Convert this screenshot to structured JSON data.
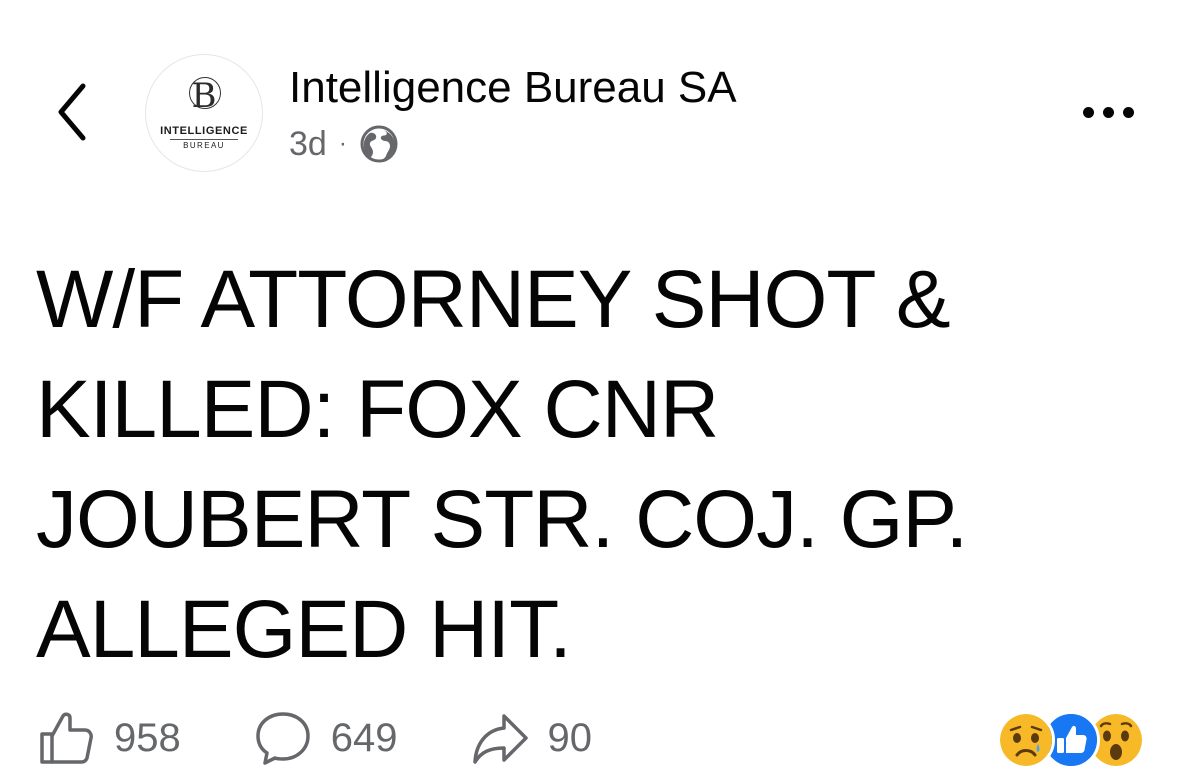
{
  "header": {
    "page_name": "Intelligence Bureau SA",
    "timestamp": "3d",
    "separator": "·",
    "audience_icon": "globe-icon"
  },
  "avatar": {
    "monogram": "B",
    "line1": "INTELLIGENCE",
    "line2": "BUREAU"
  },
  "post": {
    "text": "W/F ATTORNEY SHOT &\nKILLED: FOX CNR\nJOUBERT STR. COJ. GP.\nALLEGED HIT."
  },
  "actions": {
    "like": {
      "icon": "thumbs-up-icon",
      "count": "958"
    },
    "comment": {
      "icon": "comment-bubble-icon",
      "count": "649"
    },
    "share": {
      "icon": "share-arrow-icon",
      "count": "90"
    }
  },
  "reactions": [
    "sad-reaction-icon",
    "like-reaction-icon",
    "wow-reaction-icon"
  ],
  "colors": {
    "text_primary": "#050505",
    "text_secondary": "#65676b",
    "like_blue": "#1877f2",
    "emoji_yellow": "#f7b928"
  }
}
